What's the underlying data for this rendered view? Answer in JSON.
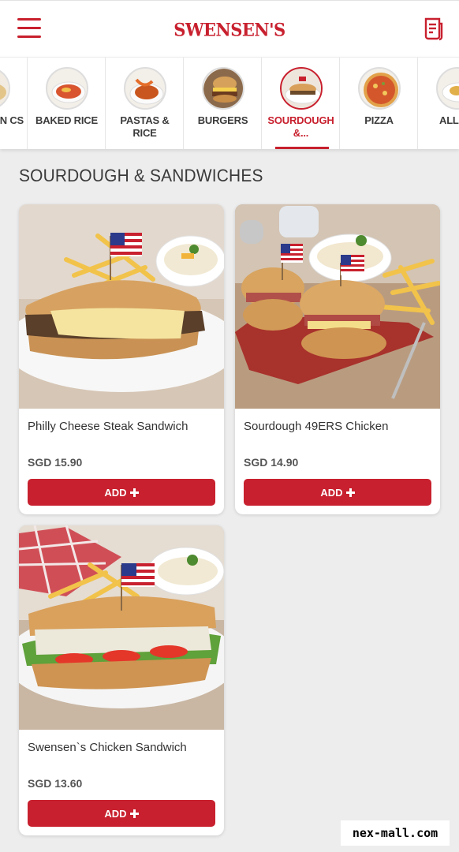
{
  "header": {
    "brand": "SWENSEN'S"
  },
  "categories": [
    {
      "label": "N CS",
      "active": false
    },
    {
      "label": "BAKED RICE",
      "active": false
    },
    {
      "label": "PASTAS & RICE",
      "active": false
    },
    {
      "label": "BURGERS",
      "active": false
    },
    {
      "label": "SOURDOUGH &...",
      "active": true
    },
    {
      "label": "PIZZA",
      "active": false
    },
    {
      "label": "ALL BRU",
      "active": false
    }
  ],
  "section": {
    "title": "SOURDOUGH & SANDWICHES"
  },
  "products": [
    {
      "name": "Philly Cheese Steak Sandwich",
      "price": "SGD 15.90",
      "add_label": "ADD"
    },
    {
      "name": "Sourdough 49ERS Chicken",
      "price": "SGD 14.90",
      "add_label": "ADD"
    },
    {
      "name": "Swensen`s Chicken Sandwich",
      "price": "SGD 13.60",
      "add_label": "ADD"
    }
  ],
  "watermark": "nex-mall.com",
  "colors": {
    "brand_red": "#c8202e",
    "background": "#ededed",
    "card": "#ffffff"
  },
  "icons": {
    "menu": "hamburger-icon",
    "orders": "receipt-icon",
    "add": "plus-icon"
  }
}
